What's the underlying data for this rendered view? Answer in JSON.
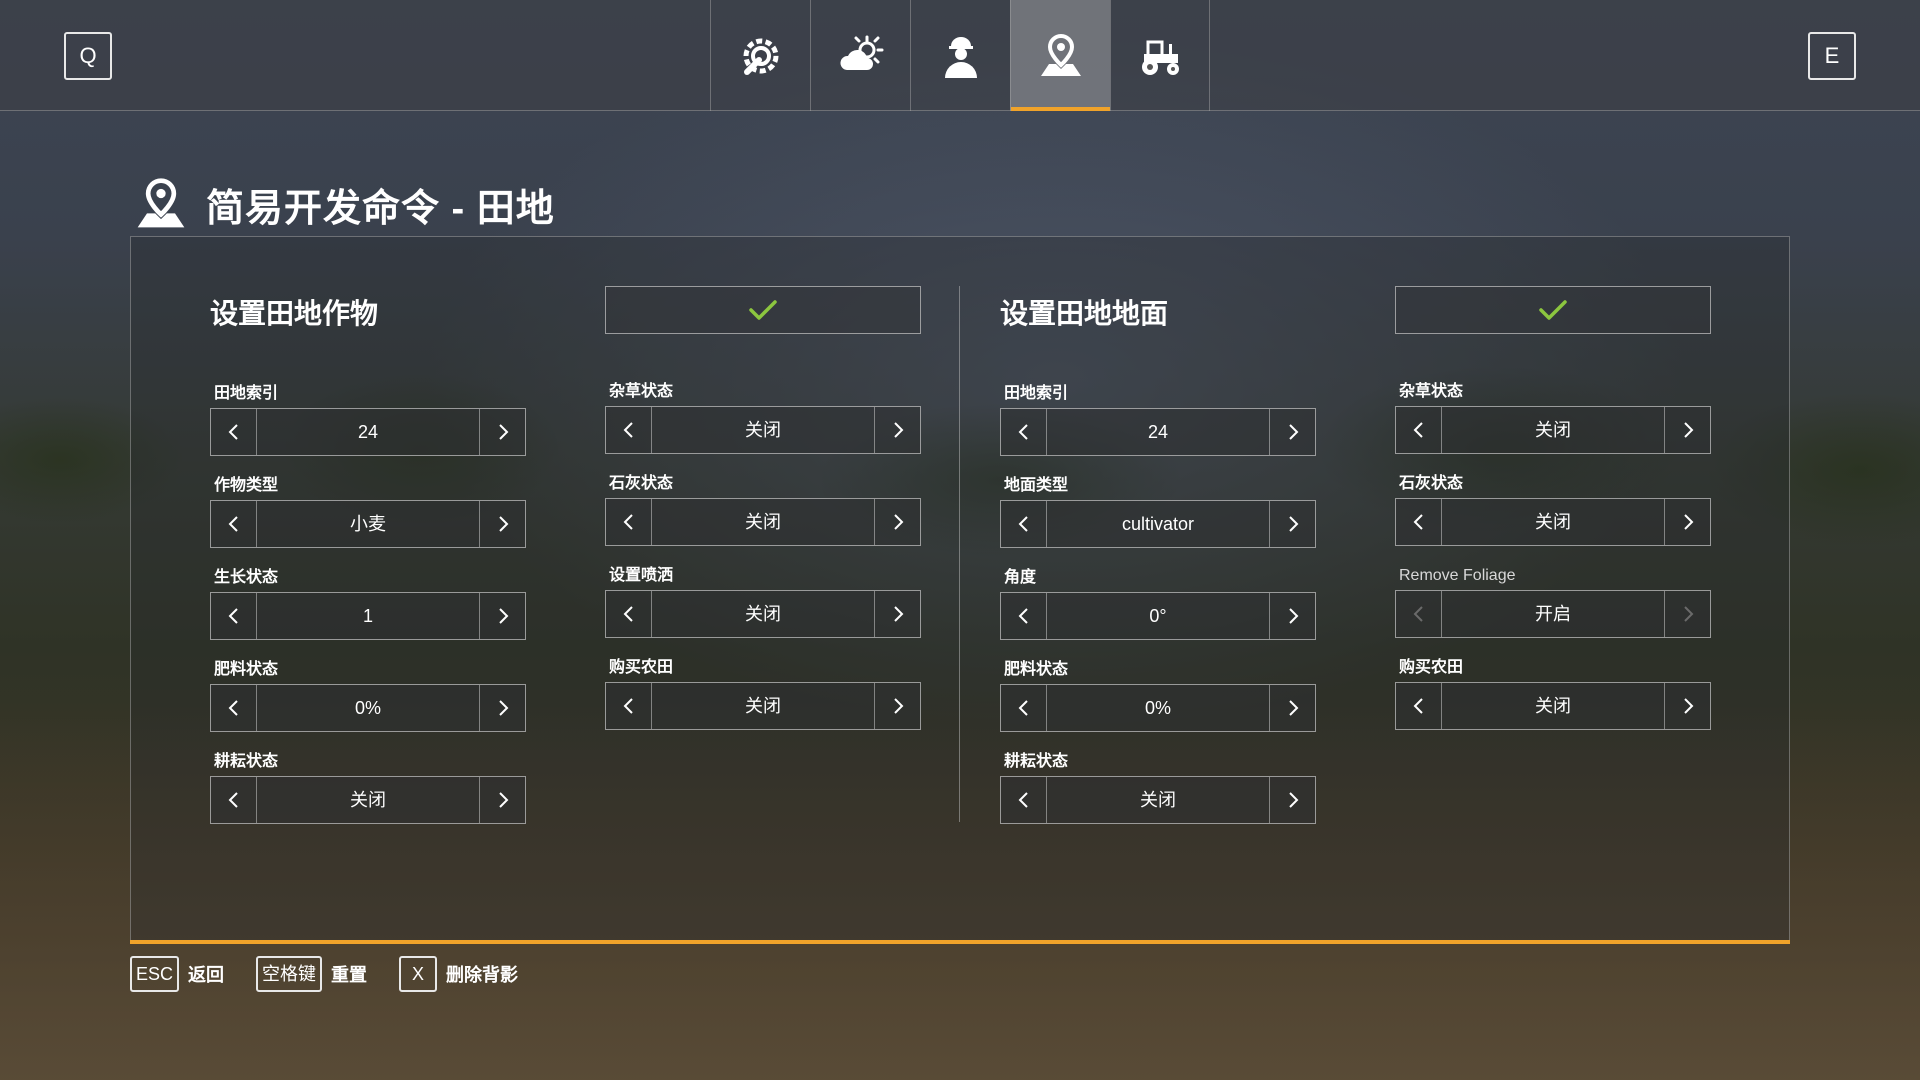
{
  "topbar": {
    "prev_key": "Q",
    "next_key": "E",
    "tabs": [
      {
        "icon": "wrench-gear-icon",
        "active": false
      },
      {
        "icon": "weather-icon",
        "active": false
      },
      {
        "icon": "farmer-icon",
        "active": false
      },
      {
        "icon": "field-pin-icon",
        "active": true
      },
      {
        "icon": "tractor-icon",
        "active": false
      }
    ]
  },
  "page": {
    "title": "简易开发命令 - 田地",
    "icon": "field-pin-icon"
  },
  "left_section": {
    "title": "设置田地作物",
    "apply_icon": "checkmark-icon",
    "fields": [
      {
        "label": "田地索引",
        "value": "24"
      },
      {
        "label": "作物类型",
        "value": "小麦"
      },
      {
        "label": "生长状态",
        "value": "1"
      },
      {
        "label": "肥料状态",
        "value": "0%"
      },
      {
        "label": "耕耘状态",
        "value": "关闭"
      }
    ],
    "fields_right": [
      {
        "label": "杂草状态",
        "value": "关闭"
      },
      {
        "label": "石灰状态",
        "value": "关闭"
      },
      {
        "label": "设置喷洒",
        "value": "关闭"
      },
      {
        "label": "购买农田",
        "value": "关闭"
      }
    ]
  },
  "right_section": {
    "title": "设置田地地面",
    "apply_icon": "checkmark-icon",
    "fields": [
      {
        "label": "田地索引",
        "value": "24"
      },
      {
        "label": "地面类型",
        "value": "cultivator"
      },
      {
        "label": "角度",
        "value": "0°"
      },
      {
        "label": "肥料状态",
        "value": "0%"
      },
      {
        "label": "耕耘状态",
        "value": "关闭"
      }
    ],
    "fields_right": [
      {
        "label": "杂草状态",
        "value": "关闭"
      },
      {
        "label": "石灰状态",
        "value": "关闭"
      },
      {
        "label": "Remove Foliage",
        "value": "开启"
      },
      {
        "label": "购买农田",
        "value": "关闭"
      }
    ]
  },
  "footer": [
    {
      "key": "ESC",
      "label": "返回"
    },
    {
      "key": "空格键",
      "label": "重置"
    },
    {
      "key": "X",
      "label": "删除背影"
    }
  ],
  "colors": {
    "accent": "#f0a32a",
    "check": "#8cc63f"
  }
}
